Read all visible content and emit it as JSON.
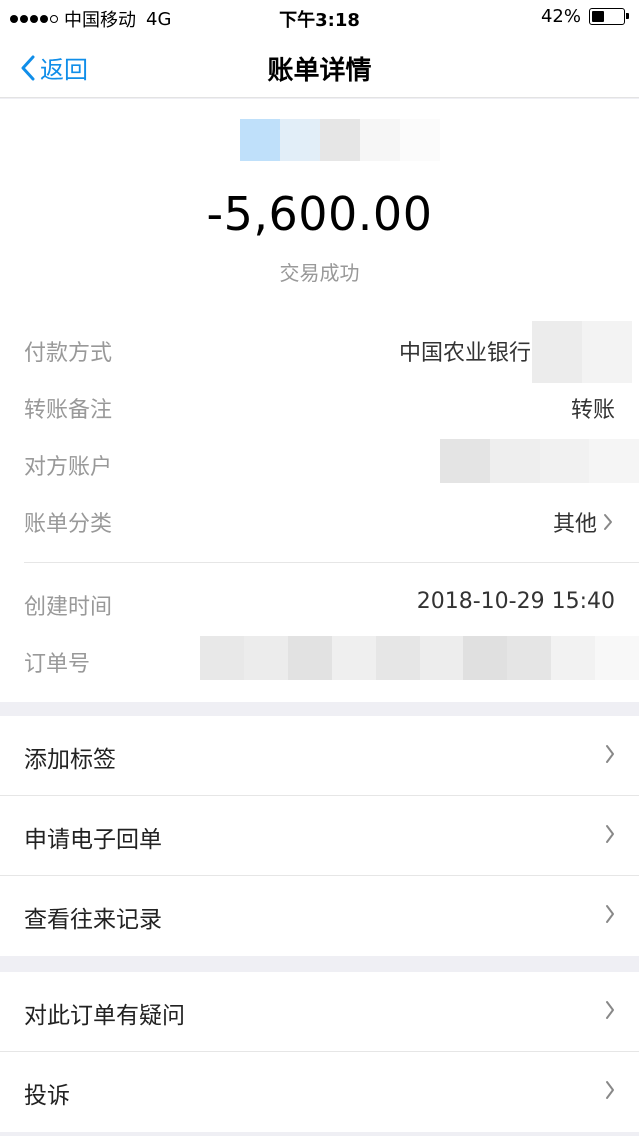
{
  "status_bar": {
    "carrier": "中国移动",
    "network": "4G",
    "time": "下午3:18",
    "battery": "42%",
    "battery_level": 0.42
  },
  "nav": {
    "back_label": "返回",
    "title": "账单详情",
    "accent_color": "#108ee9"
  },
  "summary": {
    "amount": "-5,600.00",
    "status": "交易成功"
  },
  "details": [
    {
      "label": "付款方式",
      "value": "中国农业银行"
    },
    {
      "label": "转账备注",
      "value": "转账"
    },
    {
      "label": "对方账户",
      "value": ""
    },
    {
      "label": "账单分类",
      "value": "其他"
    }
  ],
  "meta": [
    {
      "label": "创建时间",
      "value": "2018-10-29 15:40"
    },
    {
      "label": "订单号",
      "value": ""
    }
  ],
  "actions_group_1": [
    {
      "label": "添加标签"
    },
    {
      "label": "申请电子回单"
    },
    {
      "label": "查看往来记录"
    }
  ],
  "actions_group_2": [
    {
      "label": "对此订单有疑问"
    },
    {
      "label": "投诉"
    }
  ]
}
